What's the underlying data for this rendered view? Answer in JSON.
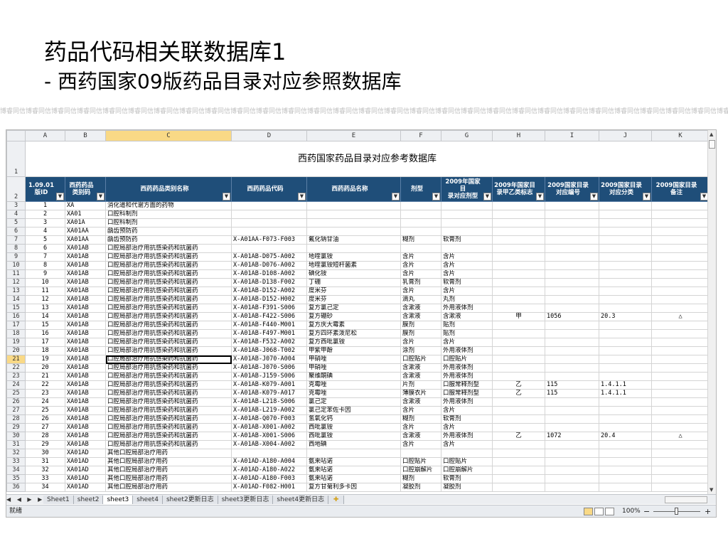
{
  "slide": {
    "title": "药品代码相关联数据库1",
    "subtitle": "- 西药国家09版药品目录对应参照数据库",
    "watermark": "博睿同信博睿同信博睿同信博睿同信博睿同信博睿同信博睿同信博睿同信博睿同信博睿同信博睿同信博睿同信博睿同信博睿同信博睿同信博睿同信博睿同信博睿同信博睿同信博睿同信博睿同信博睿同信博睿同信博睿同信博睿同信博睿同信博睿同信博睿同信博睿同信博睿同信博睿同信"
  },
  "sheet": {
    "columns": [
      "A",
      "B",
      "C",
      "D",
      "E",
      "F",
      "G",
      "H",
      "I",
      "J",
      "K"
    ],
    "selected_column": "C",
    "title_row_num": "1",
    "title": "西药国家药品目录对应参考数据库",
    "header_row_num": "2",
    "headers": [
      "1.09.01\n版ID",
      "西药药品\n类别码",
      "西药药品类别名称",
      "西药药品代码",
      "西药药品名称",
      "剂型",
      "2009年国家目\n录对应剂型",
      "2009年国家目\n录甲乙类标志",
      "2009国家目录\n对应编号",
      "2009国家目录\n对应分类",
      "2009国家目录\n备注"
    ],
    "filter_glyph": "▼",
    "selected_row": "21",
    "rows": [
      {
        "n": "3",
        "c": [
          "1",
          "XA",
          "消化道和代谢方面的药物",
          "",
          "",
          "",
          "",
          "",
          "",
          "",
          ""
        ]
      },
      {
        "n": "4",
        "c": [
          "2",
          "XA01",
          "口腔科制剂",
          "",
          "",
          "",
          "",
          "",
          "",
          "",
          ""
        ]
      },
      {
        "n": "5",
        "c": [
          "3",
          "XA01A",
          "口腔科制剂",
          "",
          "",
          "",
          "",
          "",
          "",
          "",
          ""
        ]
      },
      {
        "n": "6",
        "c": [
          "4",
          "XA01AA",
          "龋齿预防药",
          "",
          "",
          "",
          "",
          "",
          "",
          "",
          ""
        ]
      },
      {
        "n": "7",
        "c": [
          "5",
          "XA01AA",
          "龋齿预防药",
          "X-A01AA-F073-F003",
          "氟化钠甘油",
          "糊剂",
          "软膏剂",
          "",
          "",
          "",
          ""
        ]
      },
      {
        "n": "8",
        "c": [
          "6",
          "XA01AB",
          "口腔局部治疗用抗感染药和抗菌药",
          "",
          "",
          "",
          "",
          "",
          "",
          "",
          ""
        ]
      },
      {
        "n": "9",
        "c": [
          "7",
          "XA01AB",
          "口腔局部治疗用抗感染药和抗菌药",
          "X-A01AB-D075-A002",
          "地喹氯铵",
          "含片",
          "含片",
          "",
          "",
          "",
          ""
        ]
      },
      {
        "n": "10",
        "c": [
          "8",
          "XA01AB",
          "口腔局部治疗用抗感染药和抗菌药",
          "X-A01AB-D076-A002",
          "地喹氯铵短杆菌素",
          "含片",
          "含片",
          "",
          "",
          "",
          ""
        ]
      },
      {
        "n": "11",
        "c": [
          "9",
          "XA01AB",
          "口腔局部治疗用抗感染药和抗菌药",
          "X-A01AB-D108-A002",
          "碘化铵",
          "含片",
          "含片",
          "",
          "",
          "",
          ""
        ]
      },
      {
        "n": "12",
        "c": [
          "10",
          "XA01AB",
          "口腔局部治疗用抗感染药和抗菌药",
          "X-A01AB-D138-F002",
          "丁硼",
          "乳膏剂",
          "软膏剂",
          "",
          "",
          "",
          ""
        ]
      },
      {
        "n": "13",
        "c": [
          "11",
          "XA01AB",
          "口腔局部治疗用抗感染药和抗菌药",
          "X-A01AB-D152-A002",
          "度米芬",
          "含片",
          "含片",
          "",
          "",
          "",
          ""
        ]
      },
      {
        "n": "14",
        "c": [
          "12",
          "XA01AB",
          "口腔局部治疗用抗感染药和抗菌药",
          "X-A01AB-D152-H002",
          "度米芬",
          "滴丸",
          "丸剂",
          "",
          "",
          "",
          ""
        ]
      },
      {
        "n": "15",
        "c": [
          "13",
          "XA01AB",
          "口腔局部治疗用抗感染药和抗菌药",
          "X-A01AB-F391-S006",
          "复方氯己定",
          "含漱液",
          "外用液体剂",
          "",
          "",
          "",
          ""
        ]
      },
      {
        "n": "16",
        "c": [
          "14",
          "XA01AB",
          "口腔局部治疗用抗感染药和抗菌药",
          "X-A01AB-F422-S006",
          "复方硼砂",
          "含漱液",
          "含漱液",
          "甲",
          "1056",
          "20.3",
          "△"
        ]
      },
      {
        "n": "17",
        "c": [
          "15",
          "XA01AB",
          "口腔局部治疗用抗感染药和抗菌药",
          "X-A01AB-F440-M001",
          "复方庆大霉素",
          "膜剂",
          "贴剂",
          "",
          "",
          "",
          ""
        ]
      },
      {
        "n": "18",
        "c": [
          "16",
          "XA01AB",
          "口腔局部治疗用抗感染药和抗菌药",
          "X-A01AB-F497-M001",
          "复方四环素泼尼松",
          "膜剂",
          "贴剂",
          "",
          "",
          "",
          ""
        ]
      },
      {
        "n": "19",
        "c": [
          "17",
          "XA01AB",
          "口腔局部治疗用抗感染药和抗菌药",
          "X-A01AB-F532-A002",
          "复方西吡氯铵",
          "含片",
          "含片",
          "",
          "",
          "",
          ""
        ]
      },
      {
        "n": "20",
        "c": [
          "18",
          "XA01AB",
          "口腔局部治疗用抗感染药和抗菌药",
          "X-A01AB-J068-T002",
          "甲紫甲酚",
          "涂剂",
          "外用液体剂",
          "",
          "",
          "",
          ""
        ]
      },
      {
        "n": "21",
        "c": [
          "19",
          "XA01AB",
          "口腔局部治疗用抗感染药和抗菌药",
          "X-A01AB-J070-A004",
          "甲硝唑",
          "口腔贴片",
          "口腔贴片",
          "",
          "",
          "",
          ""
        ]
      },
      {
        "n": "22",
        "c": [
          "20",
          "XA01AB",
          "口腔局部治疗用抗感染药和抗菌药",
          "X-A01AB-J070-S006",
          "甲硝唑",
          "含漱液",
          "外用液体剂",
          "",
          "",
          "",
          ""
        ]
      },
      {
        "n": "23",
        "c": [
          "21",
          "XA01AB",
          "口腔局部治疗用抗感染药和抗菌药",
          "X-A01AB-J159-S006",
          "聚维酮碘",
          "含漱液",
          "外用液体剂",
          "",
          "",
          "",
          ""
        ]
      },
      {
        "n": "24",
        "c": [
          "22",
          "XA01AB",
          "口腔局部治疗用抗感染药和抗菌药",
          "X-A01AB-K079-A001",
          "克霉唑",
          "片剂",
          "口服常释剂型",
          "乙",
          "115",
          "1.4.1.1",
          ""
        ]
      },
      {
        "n": "25",
        "c": [
          "23",
          "XA01AB",
          "口腔局部治疗用抗感染药和抗菌药",
          "X-A01AB-K079-A017",
          "克霉唑",
          "薄膜衣片",
          "口服常释剂型",
          "乙",
          "115",
          "1.4.1.1",
          ""
        ]
      },
      {
        "n": "26",
        "c": [
          "24",
          "XA01AB",
          "口腔局部治疗用抗感染药和抗菌药",
          "X-A01AB-L218-S006",
          "氯己定",
          "含漱液",
          "外用液体剂",
          "",
          "",
          "",
          ""
        ]
      },
      {
        "n": "27",
        "c": [
          "25",
          "XA01AB",
          "口腔局部治疗用抗感染药和抗菌药",
          "X-A01AB-L219-A002",
          "氯己定苯佐卡因",
          "含片",
          "含片",
          "",
          "",
          "",
          ""
        ]
      },
      {
        "n": "28",
        "c": [
          "26",
          "XA01AB",
          "口腔局部治疗用抗感染药和抗菌药",
          "X-A01AB-Q070-F003",
          "氢氧化钙",
          "糊剂",
          "软膏剂",
          "",
          "",
          "",
          ""
        ]
      },
      {
        "n": "29",
        "c": [
          "27",
          "XA01AB",
          "口腔局部治疗用抗感染药和抗菌药",
          "X-A01AB-X001-A002",
          "西吡氯铵",
          "含片",
          "含片",
          "",
          "",
          "",
          ""
        ]
      },
      {
        "n": "30",
        "c": [
          "28",
          "XA01AB",
          "口腔局部治疗用抗感染药和抗菌药",
          "X-A01AB-X001-S006",
          "西吡氯铵",
          "含漱液",
          "外用液体剂",
          "乙",
          "1072",
          "20.4",
          "△"
        ]
      },
      {
        "n": "31",
        "c": [
          "29",
          "XA01AB",
          "口腔局部治疗用抗感染药和抗菌药",
          "X-A01AB-X004-A002",
          "西地碘",
          "含片",
          "含片",
          "",
          "",
          "",
          ""
        ]
      },
      {
        "n": "32",
        "c": [
          "30",
          "XA01AD",
          "其他口腔局部治疗用药",
          "",
          "",
          "",
          "",
          "",
          "",
          "",
          ""
        ]
      },
      {
        "n": "33",
        "c": [
          "31",
          "XA01AD",
          "其他口腔局部治疗用药",
          "X-A01AD-A180-A004",
          "氨来呫诺",
          "口腔贴片",
          "口腔贴片",
          "",
          "",
          "",
          ""
        ]
      },
      {
        "n": "34",
        "c": [
          "32",
          "XA01AD",
          "其他口腔局部治疗用药",
          "X-A01AD-A180-A022",
          "氨来呫诺",
          "口腔崩解片",
          "口腔崩解片",
          "",
          "",
          "",
          ""
        ]
      },
      {
        "n": "35",
        "c": [
          "33",
          "XA01AD",
          "其他口腔局部治疗用药",
          "X-A01AD-A180-F003",
          "氨来呫诺",
          "糊剂",
          "软膏剂",
          "",
          "",
          "",
          ""
        ]
      },
      {
        "n": "36",
        "c": [
          "34",
          "XA01AD",
          "其他口腔局部治疗用药",
          "X-A01AD-F082-H001",
          "复方甘菊利多卡因",
          "凝胶剂",
          "凝胶剂",
          "",
          "",
          "",
          ""
        ]
      }
    ]
  },
  "tabs": {
    "nav": "◀ ◀ ▶ ▶",
    "items": [
      "Sheet1",
      "sheet2",
      "sheet3",
      "sheet4",
      "sheet2更新日志",
      "sheet3更新日志",
      "sheet4更新日志"
    ],
    "active": "sheet3",
    "new_tab": "✚"
  },
  "status": {
    "ready": "就绪",
    "zoom": "100%",
    "minus": "−",
    "plus": "+"
  }
}
